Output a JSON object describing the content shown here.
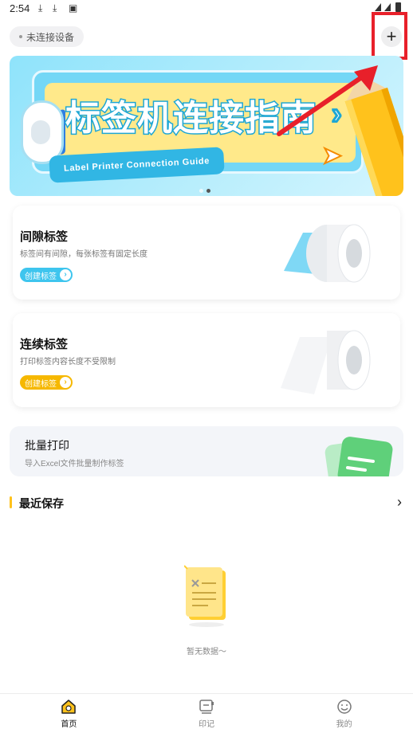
{
  "status_bar": {
    "time": "2:54"
  },
  "header": {
    "device_status": "未连接设备",
    "add_label": "+"
  },
  "banner": {
    "title": "标签机连接指南",
    "subtitle": "Label Printer Connection Guide",
    "page_index": 2,
    "page_count": 2
  },
  "cards": [
    {
      "title": "间隙标签",
      "desc": "标签间有间隙，每张标签有固定长度",
      "button": "创建标签",
      "button_color": "#3ec5ee"
    },
    {
      "title": "连续标签",
      "desc": "打印标签内容长度不受限制",
      "button": "创建标签",
      "button_color": "#f6b800"
    }
  ],
  "batch": {
    "title": "批量打印",
    "desc": "导入Excel文件批量制作标签"
  },
  "recent": {
    "title": "最近保存",
    "empty_text": "暂无数据～"
  },
  "nav": [
    {
      "label": "首页",
      "icon": "home-icon",
      "active": true
    },
    {
      "label": "印记",
      "icon": "stamp-icon",
      "active": false
    },
    {
      "label": "我的",
      "icon": "profile-icon",
      "active": false
    }
  ],
  "colors": {
    "accent": "#ffc21c",
    "highlight": "#e8202a"
  }
}
